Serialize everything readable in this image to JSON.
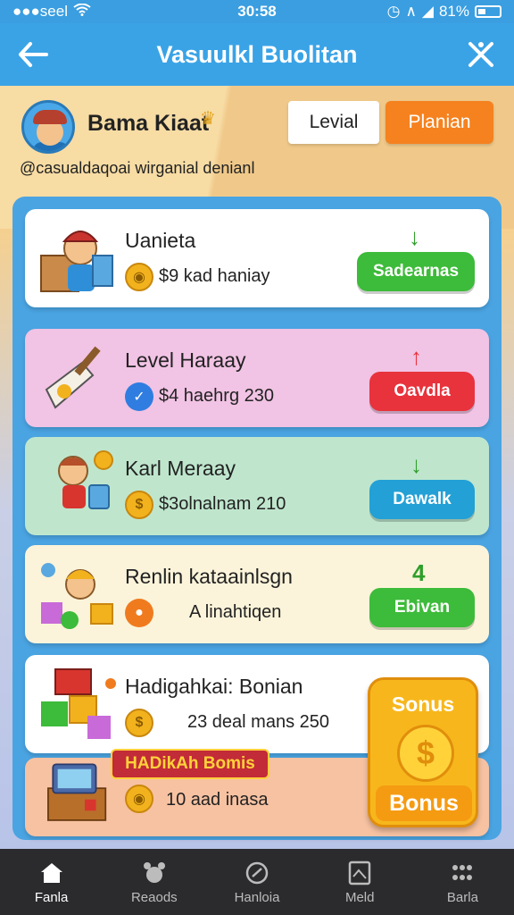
{
  "status_bar": {
    "carrier": "●●●seel",
    "time": "30:58",
    "battery": "81%"
  },
  "header": {
    "title": "Vasuulkl Buolitan"
  },
  "profile": {
    "name": "Bama Kiaat",
    "handle": "@casualdaqoai wirganial denianl",
    "level_button": "Levial",
    "plan_button": "Planian"
  },
  "cards": [
    {
      "title": "Uanieta",
      "subtitle": "$9 kad haniay",
      "button": "Sadearnas",
      "bg": "#ffffff",
      "button_color": "#3dbb3a",
      "arrow_color": "#2f9e2a",
      "icon": "coin-stack-icon",
      "illustration": "boy-with-box"
    },
    {
      "title": "Level Haraay",
      "subtitle": "$4 haehrg 230",
      "button": "Oavdla",
      "bg": "#f1c3e4",
      "button_color": "#e8323c",
      "arrow_color": "#e8323c",
      "icon": "check-icon",
      "illustration": "guitar"
    },
    {
      "title": "Karl Meraay",
      "subtitle": "$3olnalnam 210",
      "button": "Dawalk",
      "bg": "#bfe6cd",
      "button_color": "#23a0d6",
      "arrow_color": "#2f9e2a",
      "icon": "coin-icon",
      "illustration": "boy-with-coins"
    },
    {
      "title": "Renlin kataainlsgn",
      "subtitle": "A linahtiqen",
      "button": "Ebivan",
      "bg": "#fbf4da",
      "button_color": "#3dbb3a",
      "arrow_color": "#2f9e2a",
      "icon": "orange-coin-icon",
      "illustration": "boy-with-gifts"
    },
    {
      "title": "Hadigahkai: Bonian",
      "subtitle": "23 deal mans 250",
      "button": "",
      "bg": "#ffffff",
      "button_color": "",
      "arrow_color": "",
      "icon": "coin-icon",
      "illustration": "gift-boxes"
    },
    {
      "title": "",
      "subtitle": "10 aad inasa",
      "button": "",
      "bg": "#f7c2a2",
      "button_color": "",
      "arrow_color": "",
      "icon": "coin-stack-icon",
      "illustration": "treasure-chest"
    }
  ],
  "bonus": {
    "banner": "HADikAh Bomis",
    "badge_top": "Sonus",
    "badge_bottom": "Bonus"
  },
  "nav": [
    {
      "label": "Fanla",
      "icon": "home-icon"
    },
    {
      "label": "Reaods",
      "icon": "animal-icon"
    },
    {
      "label": "Hanloia",
      "icon": "gauge-icon"
    },
    {
      "label": "Meld",
      "icon": "picture-icon"
    },
    {
      "label": "Barla",
      "icon": "grid-dots-icon"
    }
  ],
  "colors": {
    "header": "#3aa3e6",
    "panel": "#4aa4e2",
    "accent_orange": "#f5821f",
    "nav_bg": "#2b2b2e"
  }
}
